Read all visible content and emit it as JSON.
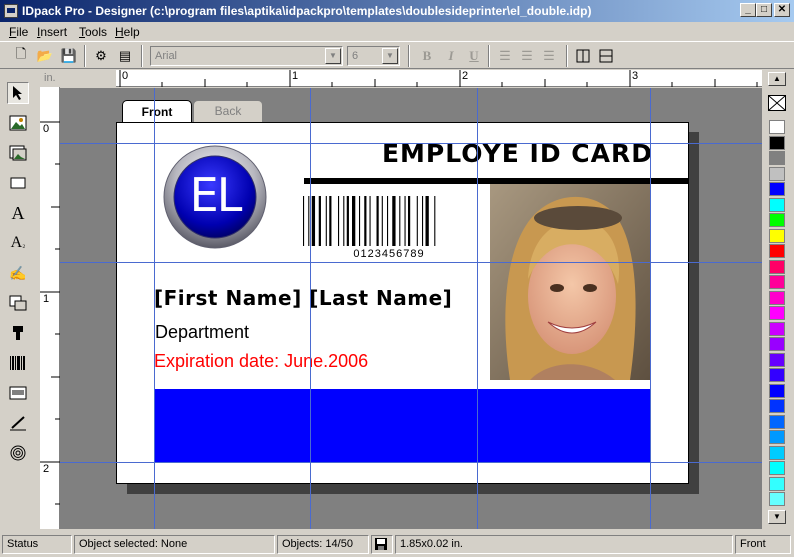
{
  "window": {
    "title": "IDpack Pro - Designer (c:\\program files\\aptika\\idpackpro\\templates\\doublesideprinter\\el_double.idp)"
  },
  "menu": [
    {
      "label": "File",
      "hot": "F",
      "rest": "ile"
    },
    {
      "label": "Insert",
      "hot": "I",
      "rest": "nsert"
    },
    {
      "label": "Tools",
      "hot": "T",
      "rest": "ools"
    },
    {
      "label": "Help",
      "hot": "H",
      "rest": "elp"
    }
  ],
  "toolbar": {
    "font": "Arial",
    "size": "6",
    "bold": "B",
    "italic": "I",
    "underline": "U"
  },
  "rulers": {
    "unit": "in.",
    "h_labels": [
      "0",
      "1",
      "2",
      "3"
    ],
    "v_labels": [
      "0",
      "1",
      "2"
    ]
  },
  "tabs": {
    "front": "Front",
    "back": "Back"
  },
  "card": {
    "title": "EMPLOYE ID CARD",
    "logo_text": "EL",
    "barcode_number": "0123456789",
    "name": "[First Name] [Last Name]",
    "department": "Department",
    "expiration": "Expiration date: June.2006"
  },
  "colors": {
    "accent_blue": "#0000ff",
    "title_blue": "#0a246a",
    "expiration_red": "#ff0000",
    "canvas_gray": "#808080"
  },
  "palette": [
    "#ffffff",
    "#000000",
    "#808080",
    "#c0c0c0",
    "#0000ff",
    "#00ffff",
    "#00ff00",
    "#ffff00",
    "#ff0000",
    "#ff0066",
    "#ff0099",
    "#ff00cc",
    "#ff00ff",
    "#cc00ff",
    "#9900ff",
    "#6600ff",
    "#3300ff",
    "#0000ff",
    "#0033ff",
    "#0066ff",
    "#0099ff",
    "#00ccff",
    "#00ffff",
    "#33ffff",
    "#66ffff"
  ],
  "status": {
    "label": "Status",
    "selected": "Object selected: None",
    "objects": "Objects: 14/50",
    "size": "1.85x0.02 in.",
    "side": "Front"
  }
}
